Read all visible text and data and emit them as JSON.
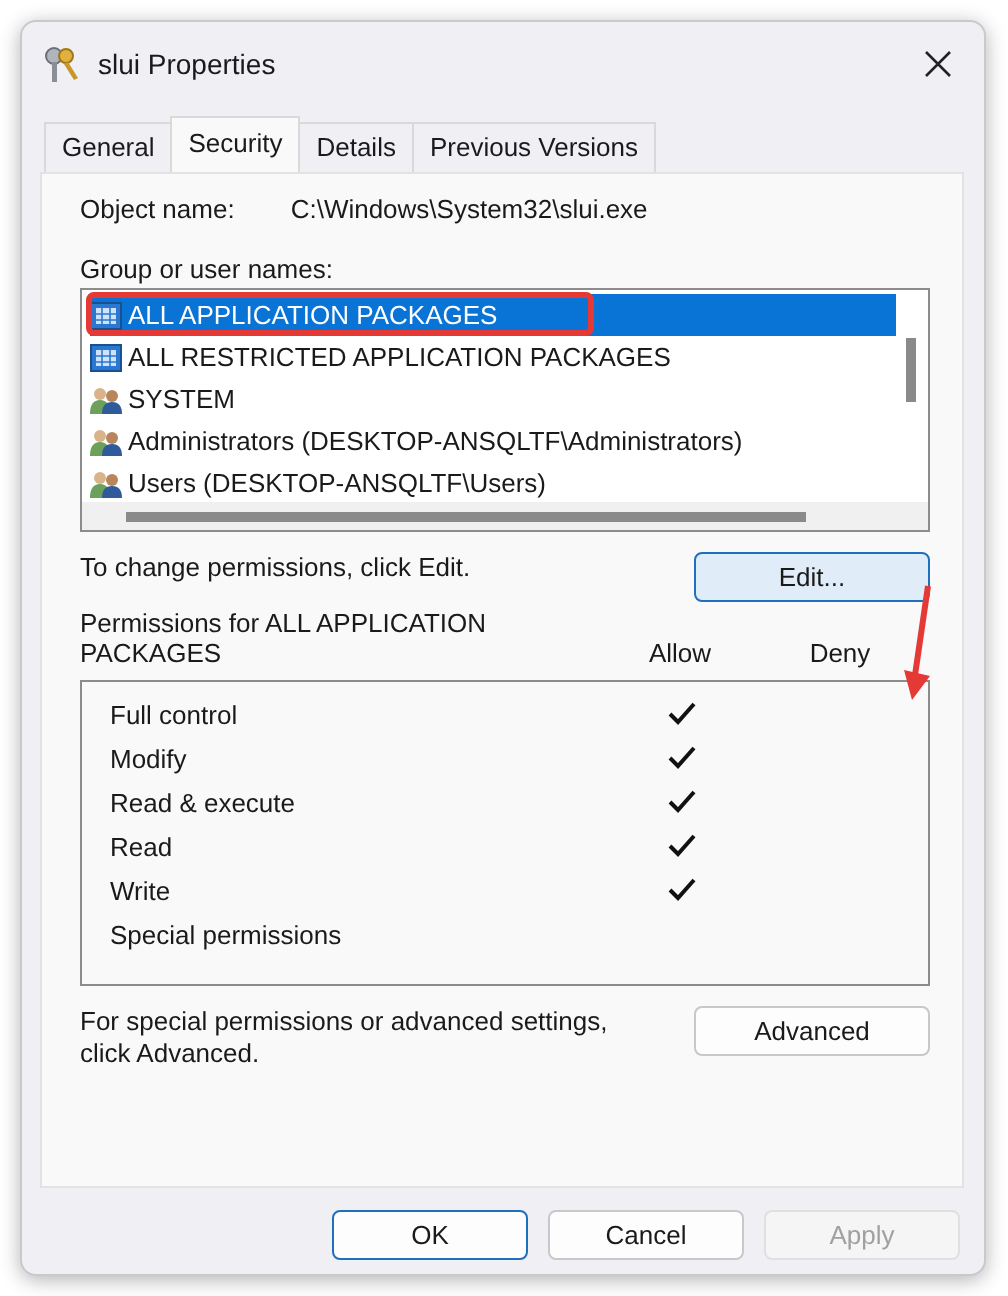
{
  "window": {
    "title": "slui Properties"
  },
  "tabs": [
    {
      "label": "General",
      "selected": false
    },
    {
      "label": "Security",
      "selected": true
    },
    {
      "label": "Details",
      "selected": false
    },
    {
      "label": "Previous Versions",
      "selected": false
    }
  ],
  "object_name": {
    "label": "Object name:",
    "value": "C:\\Windows\\System32\\slui.exe"
  },
  "group_list": {
    "label": "Group or user names:",
    "items": [
      {
        "name": "ALL APPLICATION PACKAGES",
        "kind": "package",
        "selected": true,
        "highlighted": true
      },
      {
        "name": "ALL RESTRICTED APPLICATION PACKAGES",
        "kind": "package",
        "selected": false,
        "highlighted": false
      },
      {
        "name": "SYSTEM",
        "kind": "users",
        "selected": false,
        "highlighted": false
      },
      {
        "name": "Administrators (DESKTOP-ANSQLTF\\Administrators)",
        "kind": "users",
        "selected": false,
        "highlighted": false
      },
      {
        "name": "Users (DESKTOP-ANSQLTF\\Users)",
        "kind": "users",
        "selected": false,
        "highlighted": false
      }
    ]
  },
  "edit_hint": "To change permissions, click Edit.",
  "edit_button": {
    "label": "Edit...",
    "focused": true
  },
  "permissions": {
    "label": "Permissions for ALL APPLICATION PACKAGES",
    "allow_header": "Allow",
    "deny_header": "Deny",
    "rows": [
      {
        "name": "Full control",
        "allow": true,
        "deny": false
      },
      {
        "name": "Modify",
        "allow": true,
        "deny": false
      },
      {
        "name": "Read & execute",
        "allow": true,
        "deny": false
      },
      {
        "name": "Read",
        "allow": true,
        "deny": false
      },
      {
        "name": "Write",
        "allow": true,
        "deny": false
      },
      {
        "name": "Special permissions",
        "allow": false,
        "deny": false
      }
    ]
  },
  "advanced_hint": "For special permissions or advanced settings, click Advanced.",
  "advanced_button": {
    "label": "Advanced"
  },
  "buttons": [
    {
      "label": "OK",
      "default": true,
      "disabled": false
    },
    {
      "label": "Cancel",
      "default": false,
      "disabled": false
    },
    {
      "label": "Apply",
      "default": false,
      "disabled": true
    }
  ]
}
